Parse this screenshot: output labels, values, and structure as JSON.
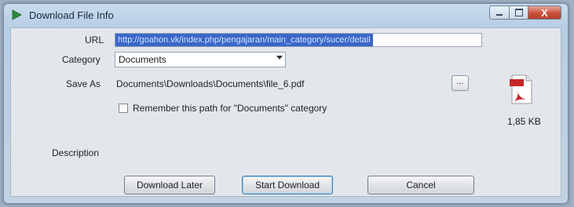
{
  "window": {
    "title": "Download File Info",
    "close_glyph": "X"
  },
  "form": {
    "url_label": "URL",
    "url_value": "http://goahon.vk/index.php/pengajaran/main_category/sucer/detail",
    "category_label": "Category",
    "category_value": "Documents",
    "save_as_label": "Save As",
    "save_as_value": "Documents\\Downloads\\Documents\\file_6.pdf",
    "browse_label": "...",
    "remember_label": "Remember this path for \"Documents\" category",
    "remember_checked": false,
    "description_label": "Description"
  },
  "file": {
    "icon": "pdf-file-icon",
    "size": "1,85 KB"
  },
  "buttons": {
    "download_later": "Download Later",
    "start_download": "Start Download",
    "cancel": "Cancel"
  },
  "colors": {
    "selection": "#3a67c8",
    "title_bar": "#c9dcef",
    "close_button": "#c9523c",
    "pdf_red": "#c62828"
  }
}
